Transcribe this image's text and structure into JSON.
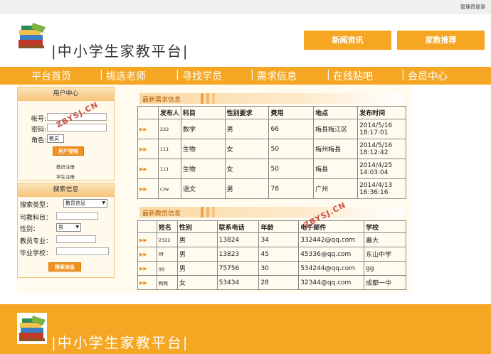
{
  "header": {
    "admin_login": "管理员登录",
    "site_title": "|中小学生家教平台|",
    "btn_news": "新闻资讯",
    "btn_recommend": "家教推荐"
  },
  "nav": [
    {
      "label": "平台首页"
    },
    {
      "label": "挑选老师"
    },
    {
      "label": "寻找学员"
    },
    {
      "label": "需求信息"
    },
    {
      "label": "在线贴吧"
    },
    {
      "label": "会员中心"
    }
  ],
  "user_center": {
    "title": "用户中心",
    "account_label": "帐号:",
    "password_label": "密码:",
    "role_label": "角色:",
    "role_value": "教员",
    "login_button": "用户登陆",
    "teacher_register": "教员注册",
    "student_register": "学生注册"
  },
  "search": {
    "title": "搜索信息",
    "type_label": "搜索类型：",
    "type_value": "教员信息",
    "subject_label": "可教科目：",
    "gender_label": "性别：",
    "gender_value": "男",
    "major_label": "教员专业：",
    "school_label": "毕业学校：",
    "search_button": "搜索信息"
  },
  "demand": {
    "section_title": "最新需求信息",
    "columns": [
      "发布人",
      "科目",
      "性别要求",
      "费用",
      "地点",
      "发布时间"
    ],
    "rows": [
      {
        "publisher": "222",
        "subject": "数学",
        "gender": "男",
        "fee": "66",
        "place": "梅县梅江区",
        "date": "2014/5/16",
        "time": "18:17:01"
      },
      {
        "publisher": "111",
        "subject": "生物",
        "gender": "女",
        "fee": "50",
        "place": "梅州梅县",
        "date": "2014/5/16",
        "time": "18:12:42"
      },
      {
        "publisher": "111",
        "subject": "生物",
        "gender": "女",
        "fee": "50",
        "place": "梅县",
        "date": "2014/4/25",
        "time": "14:03:04"
      },
      {
        "publisher": "czw",
        "subject": "语文",
        "gender": "男",
        "fee": "78",
        "place": "广州",
        "date": "2014/4/13",
        "time": "16:36:16"
      }
    ]
  },
  "teachers": {
    "section_title": "最新教员信息",
    "columns": [
      "姓名",
      "性别",
      "联系电话",
      "年龄",
      "电子邮件",
      "学校"
    ],
    "rows": [
      {
        "name": "2322",
        "gender": "男",
        "phone": "13824",
        "age": "34",
        "email": "332442@qq.com",
        "school": "嘉大"
      },
      {
        "name": "fff",
        "gender": "男",
        "phone": "13823",
        "age": "45",
        "email": "45336@qq.com",
        "school": "东山中学"
      },
      {
        "name": "gg",
        "gender": "男",
        "phone": "75756",
        "age": "30",
        "email": "534244@qq.com",
        "school": "gg"
      },
      {
        "name": "鸭鸭",
        "gender": "女",
        "phone": "53434",
        "age": "28",
        "email": "32344@qq.com",
        "school": "成都一中"
      }
    ]
  },
  "watermark": "ZBYSJ.CN",
  "footer": {
    "site_title": "|中小学生家教平台|"
  },
  "colors": {
    "accent": "#f5a623",
    "button": "#f0901e",
    "section_text": "#b05a00"
  }
}
